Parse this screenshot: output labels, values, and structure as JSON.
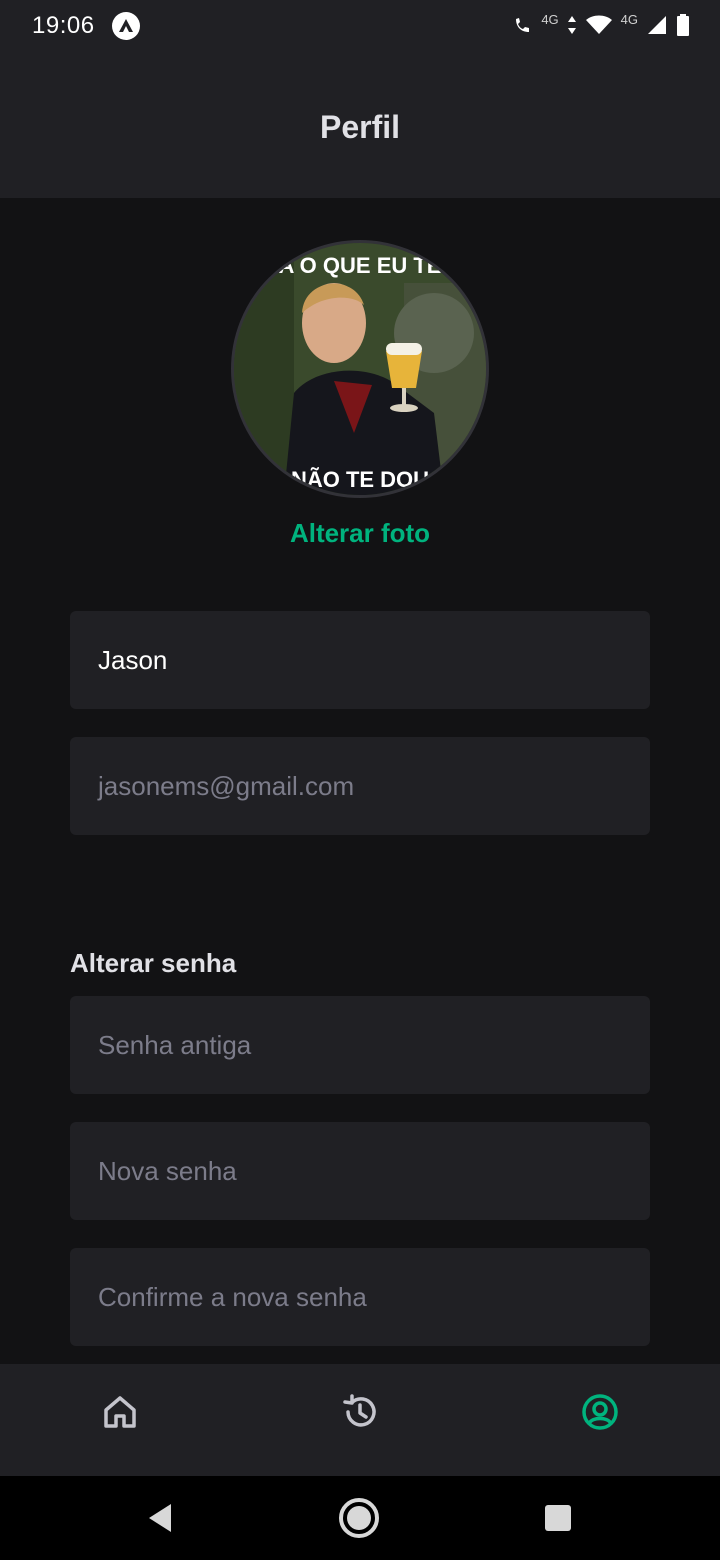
{
  "status_bar": {
    "time": "19:06",
    "call_network_label": "4G",
    "mobile_network_label": "4G",
    "icons": [
      "app-notification-icon",
      "volte-call-icon",
      "data-arrows-icon",
      "wifi-icon",
      "cell-signal-icon",
      "battery-icon"
    ]
  },
  "header": {
    "title": "Perfil"
  },
  "profile": {
    "avatar_caption_top": "A O QUE EU TE",
    "avatar_caption_bottom": "NÃO TE DOU",
    "change_photo_label": "Alterar foto"
  },
  "form": {
    "name_value": "Jason",
    "email_placeholder": "jasonems@gmail.com"
  },
  "password": {
    "section_title": "Alterar senha",
    "old_placeholder": "Senha antiga",
    "new_placeholder": "Nova senha",
    "confirm_placeholder": "Confirme a nova senha"
  },
  "tabbar": {
    "tabs": [
      {
        "icon": "home-icon",
        "active": false
      },
      {
        "icon": "history-icon",
        "active": false
      },
      {
        "icon": "user-circle-icon",
        "active": true
      }
    ]
  },
  "navbar": {
    "icons": [
      "back-icon",
      "home-circle-icon",
      "recents-icon"
    ]
  },
  "colors": {
    "background": "#121214",
    "surface": "#202024",
    "accent": "#00b37e",
    "text": "#e1e1e6",
    "placeholder": "#7c7c8a"
  }
}
